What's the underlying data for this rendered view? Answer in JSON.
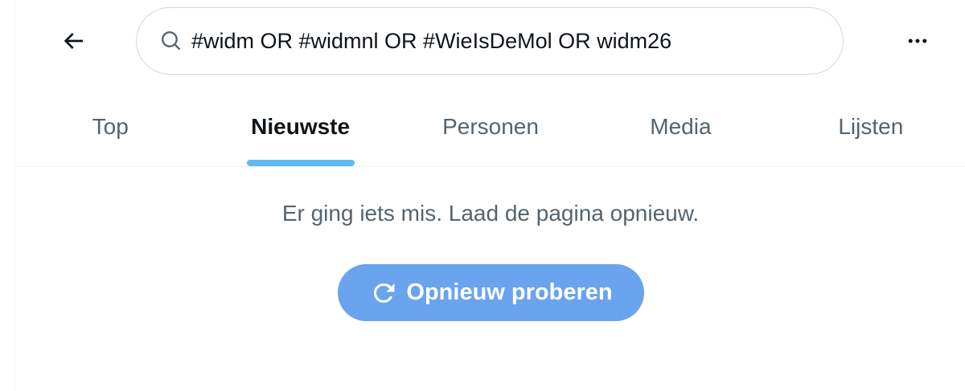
{
  "header": {
    "search": {
      "value": "#widm OR #widmnl OR #WieIsDeMol OR widm26"
    }
  },
  "tabs": [
    {
      "label": "Top",
      "active": false
    },
    {
      "label": "Nieuwste",
      "active": true
    },
    {
      "label": "Personen",
      "active": false
    },
    {
      "label": "Media",
      "active": false
    },
    {
      "label": "Lijsten",
      "active": false
    }
  ],
  "error": {
    "message": "Er ging iets mis. Laad de pagina opnieuw.",
    "retry_label": "Opnieuw proberen"
  },
  "colors": {
    "accent": "#1d9bf0",
    "retry_button": "#6aa3ee",
    "muted_text": "#536471",
    "border": "#cfd9de"
  },
  "icons": {
    "back": "arrow-left-icon",
    "search": "magnifier-icon",
    "more": "more-horizontal-icon",
    "retry": "refresh-icon"
  }
}
